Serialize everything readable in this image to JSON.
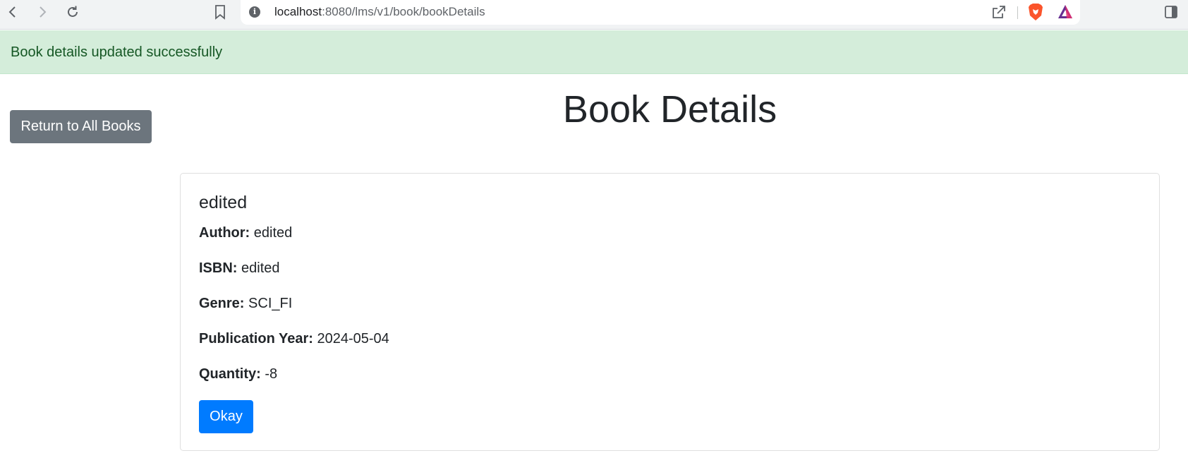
{
  "browser": {
    "url_host": "localhost",
    "url_path": ":8080/lms/v1/book/bookDetails",
    "icons": [
      "back-icon",
      "forward-icon",
      "reload-icon",
      "bookmark-icon",
      "info-icon",
      "share-icon",
      "brave-icon",
      "rewards-icon",
      "sidepanel-icon"
    ]
  },
  "alert": {
    "message": "Book details updated successfully",
    "color": "#155724",
    "background": "#d4edda"
  },
  "actions": {
    "return_label": "Return to All Books",
    "okay_label": "Okay"
  },
  "page": {
    "title": "Book Details"
  },
  "book": {
    "title": "edited",
    "fields": [
      {
        "label": "Author:",
        "value": "edited"
      },
      {
        "label": "ISBN:",
        "value": "edited"
      },
      {
        "label": "Genre:",
        "value": "SCI_FI"
      },
      {
        "label": "Publication Year:",
        "value": "2024-05-04"
      },
      {
        "label": "Quantity:",
        "value": "-8"
      }
    ]
  },
  "colors": {
    "primary": "#007bff",
    "secondary": "#6c757d"
  }
}
